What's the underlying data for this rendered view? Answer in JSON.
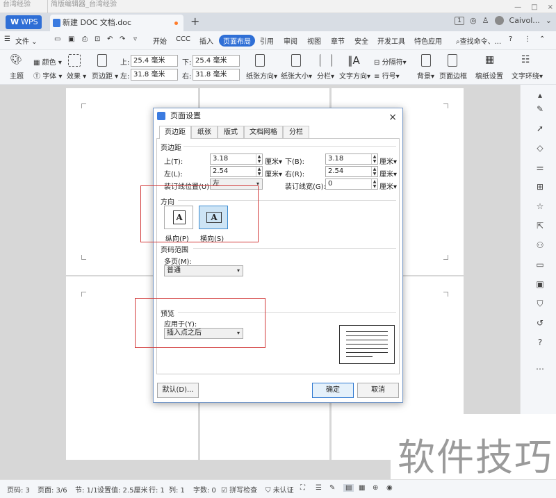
{
  "browser_tabs": [
    "台湾经验",
    "简版编辑器_台湾经验"
  ],
  "app": {
    "wps_label": "WPS",
    "doc_tab": "新建 DOC 文档.doc",
    "new_tab_symbol": "+",
    "page_count_badge": "1",
    "user": "Caivol...",
    "window_controls": [
      "—",
      "□",
      "×"
    ]
  },
  "menu": {
    "file": "文件",
    "tabs": [
      "开始",
      "CCC",
      "插入",
      "页面布局",
      "引用",
      "审阅",
      "视图",
      "章节",
      "安全",
      "开发工具",
      "特色应用"
    ],
    "active": "页面布局",
    "search": "查找命令、..."
  },
  "ribbon": {
    "theme": "主题",
    "colors": "颜色",
    "fonts": "字体",
    "effects": "效果",
    "margins": "页边距",
    "top_label": "上:",
    "top_value": "25.4 毫米",
    "bottom_label": "下:",
    "bottom_value": "25.4 毫米",
    "left_label": "左:",
    "left_value": "31.8 毫米",
    "right_label": "右:",
    "right_value": "31.8 毫米",
    "orientation": "纸张方向",
    "size": "纸张大小",
    "columns": "分栏",
    "text_direction": "文字方向",
    "breaks": "分隔符",
    "line_numbers": "行号",
    "background": "背景",
    "page_border": "页面边框",
    "draft_paper": "稿纸设置",
    "text_wrap": "文字环绕"
  },
  "dialog": {
    "title": "页面设置",
    "close": "×",
    "tabs": [
      "页边距",
      "纸张",
      "版式",
      "文档网格",
      "分栏"
    ],
    "margins_section": "页边距",
    "top_label": "上(T):",
    "top_value": "3.18",
    "bottom_label": "下(B):",
    "bottom_value": "3.18",
    "left_label": "左(L):",
    "left_value": "2.54",
    "right_label": "右(R):",
    "right_value": "2.54",
    "unit": "厘米",
    "gutter_pos_label": "装订线位置(U):",
    "gutter_pos_value": "左",
    "gutter_width_label": "装订线宽(G):",
    "gutter_width_value": "0",
    "orientation_section": "方向",
    "portrait": "纵向(P)",
    "landscape": "横向(S)",
    "page_range_section": "页码范围",
    "multi_label": "多页(M):",
    "multi_value": "普通",
    "preview_section": "预览",
    "apply_label": "应用于(Y):",
    "apply_value": "插入点之后",
    "default_btn": "默认(D)...",
    "ok_btn": "确定",
    "cancel_btn": "取消"
  },
  "status": {
    "page": "页码: 3",
    "pages": "页面: 3/6",
    "section": "节: 1/1",
    "setting": "设置值: 2.5厘米",
    "row": "行: 1",
    "col": "列: 1",
    "words": "字数: 0",
    "spell": "拼写检查",
    "cert": "未认证"
  },
  "watermark": "软件技巧",
  "accent_color": "#2f6fd6",
  "highlight_color": "#d23a3a"
}
